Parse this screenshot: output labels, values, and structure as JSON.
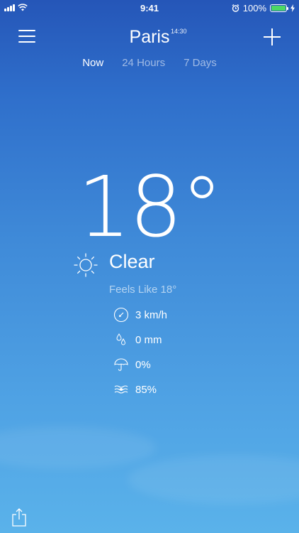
{
  "status_bar": {
    "time": "9:41",
    "battery": "100%"
  },
  "header": {
    "city": "Paris",
    "local_time": "14:30"
  },
  "tabs": [
    {
      "label": "Now",
      "active": true
    },
    {
      "label": "24 Hours",
      "active": false
    },
    {
      "label": "7 Days",
      "active": false
    }
  ],
  "weather": {
    "temperature": "18°",
    "condition": "Clear",
    "feels_like": "Feels Like 18°",
    "wind": "3 km/h",
    "precipitation": "0 mm",
    "precip_chance": "0%",
    "humidity": "85%"
  },
  "icons": {
    "menu": "hamburger-icon",
    "add": "plus-icon",
    "condition": "sun-icon",
    "wind": "compass-icon",
    "precipitation": "raindrops-icon",
    "precip_chance": "umbrella-icon",
    "humidity": "humidity-icon",
    "share": "share-icon"
  },
  "colors": {
    "background_top": "#2556b8",
    "background_bottom": "#5ab2ea",
    "battery_fill": "#4cd964"
  }
}
